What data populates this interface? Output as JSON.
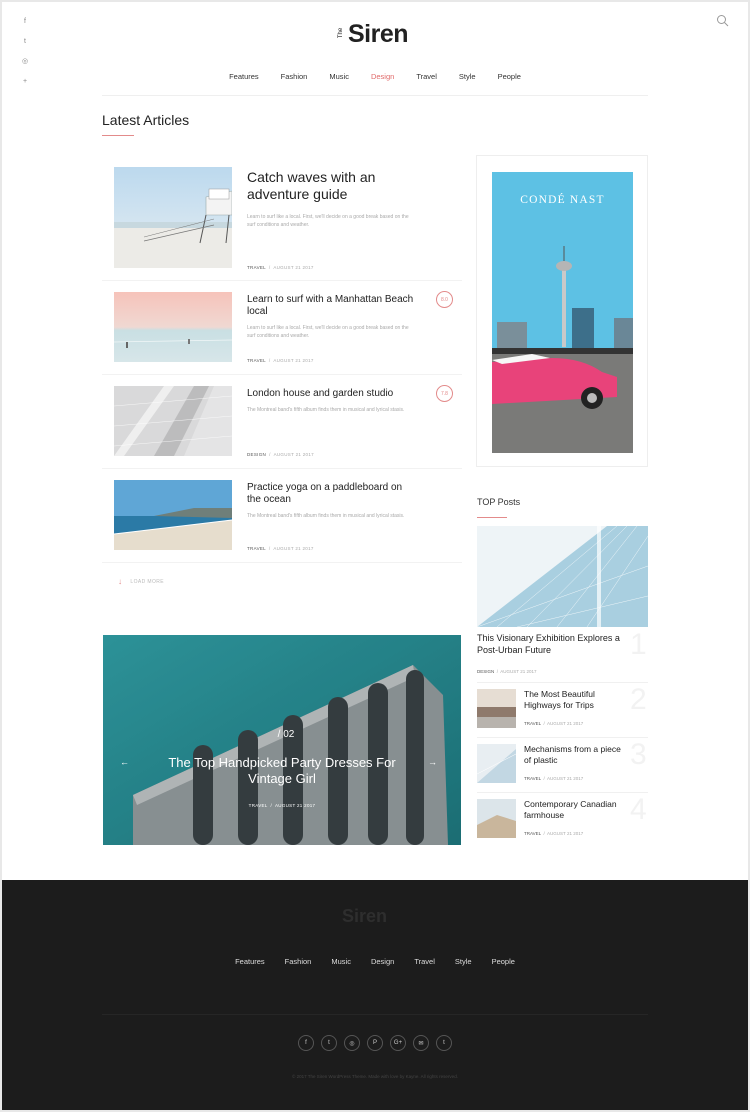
{
  "brand": {
    "prefix": "The",
    "name": "Siren"
  },
  "social_rail": [
    {
      "icon": "facebook-icon",
      "glyph": "f"
    },
    {
      "icon": "twitter-icon",
      "glyph": "t"
    },
    {
      "icon": "instagram-icon",
      "glyph": "◎"
    },
    {
      "icon": "plus-icon",
      "glyph": "+"
    }
  ],
  "nav": [
    {
      "label": "Features",
      "active": false
    },
    {
      "label": "Fashion",
      "active": false
    },
    {
      "label": "Music",
      "active": false
    },
    {
      "label": "Design",
      "active": true
    },
    {
      "label": "Travel",
      "active": false
    },
    {
      "label": "Style",
      "active": false
    },
    {
      "label": "People",
      "active": false
    }
  ],
  "latest": {
    "title": "Latest Articles",
    "articles": [
      {
        "title": "Catch waves with an adventure guide",
        "excerpt": "Learn to surf like a local. First, we'll decide on a good break based on the surf conditions and weather.",
        "category": "TRAVEL",
        "date": "AUGUST 21 2017",
        "score": ""
      },
      {
        "title": "Learn to surf with a Manhattan Beach local",
        "excerpt": "Learn to surf like a local. First, we'll decide on a good break based on the surf conditions and weather.",
        "category": "TRAVEL",
        "date": "AUGUST 21 2017",
        "score": "8.0"
      },
      {
        "title": "London house and garden studio",
        "excerpt": "The Montreal band's fifth album finds them in musical and lyrical stasis.",
        "category": "DESIGN",
        "date": "AUGUST 21 2017",
        "score": "7.8"
      },
      {
        "title": "Practice yoga on a paddleboard on the ocean",
        "excerpt": "The Montreal band's fifth album finds them in musical and lyrical stasis.",
        "category": "TRAVEL",
        "date": "AUGUST 21 2017",
        "score": ""
      }
    ],
    "load_more": "LOAD MORE"
  },
  "slider": {
    "number": "02",
    "title": "The Top Handpicked Party Dresses For Vintage Girl",
    "category": "TRAVEL",
    "date": "AUGUST 21 2017"
  },
  "ad": {
    "brand": "CONDÉ NAST"
  },
  "top_posts": {
    "title": "TOP Posts",
    "featured": {
      "title": "This Visionary Exhibition Explores a Post-Urban Future",
      "category": "DESIGN",
      "date": "AUGUST 21 2017",
      "rank": "1"
    },
    "items": [
      {
        "title": "The Most Beautiful Highways for Trips",
        "category": "TRAVEL",
        "date": "AUGUST 21 2017",
        "rank": "2"
      },
      {
        "title": "Mechanisms from a piece of plastic",
        "category": "TRAVEL",
        "date": "AUGUST 21 2017",
        "rank": "3"
      },
      {
        "title": "Contemporary Canadian farmhouse",
        "category": "TRAVEL",
        "date": "AUGUST 21 2017",
        "rank": "4"
      }
    ]
  },
  "footer": {
    "nav": [
      "Features",
      "Fashion",
      "Music",
      "Design",
      "Travel",
      "Style",
      "People"
    ],
    "social": [
      {
        "icon": "facebook-icon",
        "glyph": "f"
      },
      {
        "icon": "twitter-icon",
        "glyph": "t"
      },
      {
        "icon": "instagram-icon",
        "glyph": "◎"
      },
      {
        "icon": "pinterest-icon",
        "glyph": "P"
      },
      {
        "icon": "googleplus-icon",
        "glyph": "G+"
      },
      {
        "icon": "email-icon",
        "glyph": "✉"
      },
      {
        "icon": "tumblr-icon",
        "glyph": "t"
      }
    ],
    "copyright": "© 2017 The Siren WordPress Theme. Made with love by Kayne. All rights reserved."
  },
  "colors": {
    "accent": "#e06a6a",
    "footer_bg": "#1c1c1c",
    "slider_teal": "#2f9ba0",
    "ad_sky": "#5cc3e5",
    "car_pink": "#e8437a"
  }
}
